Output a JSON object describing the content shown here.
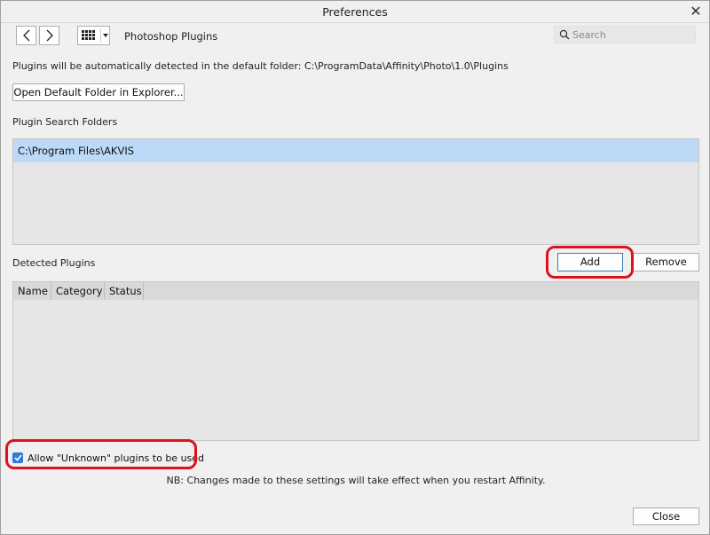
{
  "window": {
    "title": "Preferences"
  },
  "toolbar": {
    "back_icon": "chevron-left-icon",
    "forward_icon": "chevron-right-icon",
    "grid_icon": "grid-icon",
    "section_label": "Photoshop Plugins",
    "search_placeholder": "Search"
  },
  "main": {
    "info_text": "Plugins will be automatically detected in the default folder: C:\\ProgramData\\Affinity\\Photo\\1.0\\Plugins",
    "open_folder_label": "Open Default Folder in Explorer...",
    "search_folders_label": "Plugin Search Folders",
    "search_folders": [
      "C:\\Program Files\\AKVIS"
    ],
    "detected_label": "Detected Plugins",
    "add_label": "Add",
    "remove_label": "Remove",
    "columns": [
      "Name",
      "Category",
      "Status"
    ],
    "allow_unknown_label": "Allow \"Unknown\" plugins to be used",
    "allow_unknown_checked": true,
    "restart_note": "NB: Changes made to these settings will take effect when you restart Affinity."
  },
  "footer": {
    "close_label": "Close"
  },
  "colors": {
    "selection": "#bcd9f7",
    "highlight": "#e0101c",
    "checkbox": "#2e7bd6"
  }
}
